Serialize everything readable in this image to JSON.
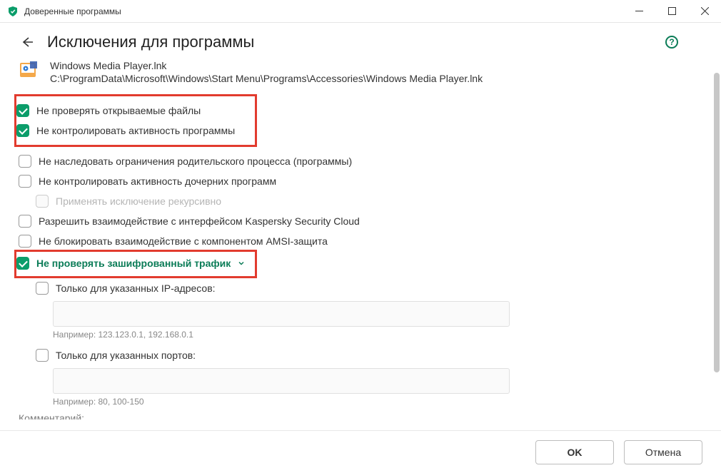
{
  "titlebar": {
    "title": "Доверенные программы"
  },
  "header": {
    "page_title": "Исключения для программы",
    "help": "?"
  },
  "file": {
    "name": "Windows Media Player.lnk",
    "path": "C:\\ProgramData\\Microsoft\\Windows\\Start Menu\\Programs\\Accessories\\Windows Media Player.lnk"
  },
  "options": {
    "scan_opened_files": "Не проверять открываемые файлы",
    "monitor_activity": "Не контролировать активность программы",
    "inherit_parent": "Не наследовать ограничения родительского процесса (программы)",
    "monitor_children": "Не контролировать активность дочерних программ",
    "apply_recursive": "Применять исключение рекурсивно",
    "allow_ksc": "Разрешить взаимодействие с интерфейсом Kaspersky Security Cloud",
    "block_amsi": "Не блокировать взаимодействие с компонентом AMSI-защита",
    "encrypted_traffic": "Не проверять зашифрованный трафик",
    "only_ips": "Только для указанных IP-адресов:",
    "ip_hint": "Например: 123.123.0.1, 192.168.0.1",
    "only_ports": "Только для указанных портов:",
    "port_hint": "Например: 80, 100-150",
    "comment_label": "Комментарий:"
  },
  "footer": {
    "ok": "OK",
    "cancel": "Отмена"
  },
  "colors": {
    "accent": "#0b9d6a",
    "highlight": "#e23b2e"
  }
}
